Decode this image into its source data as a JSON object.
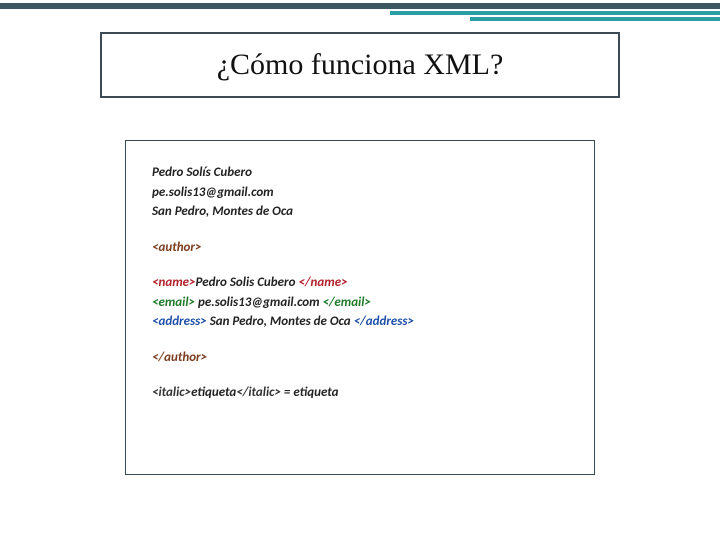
{
  "title": "¿Cómo funciona XML?",
  "plain": {
    "name": "Pedro Solís Cubero",
    "email": "pe.solis13@gmail.com",
    "address": "San Pedro, Montes de Oca"
  },
  "tags": {
    "author_open": "<author>",
    "author_close": "</author>",
    "name_open": "<name>",
    "name_close": "</name>",
    "email_open": "<email>",
    "email_close": "</email>",
    "address_open": "<address>",
    "address_close": "</address>",
    "italic_open": "<italic>",
    "italic_close": "</italic>"
  },
  "xml_values": {
    "name_val": "Pedro Solis Cubero ",
    "email_val": " pe.solis13@gmail.com ",
    "address_val": " San Pedro, Montes de Oca "
  },
  "eq": {
    "inner": "etiqueta",
    "rhs": " = etiqueta"
  }
}
